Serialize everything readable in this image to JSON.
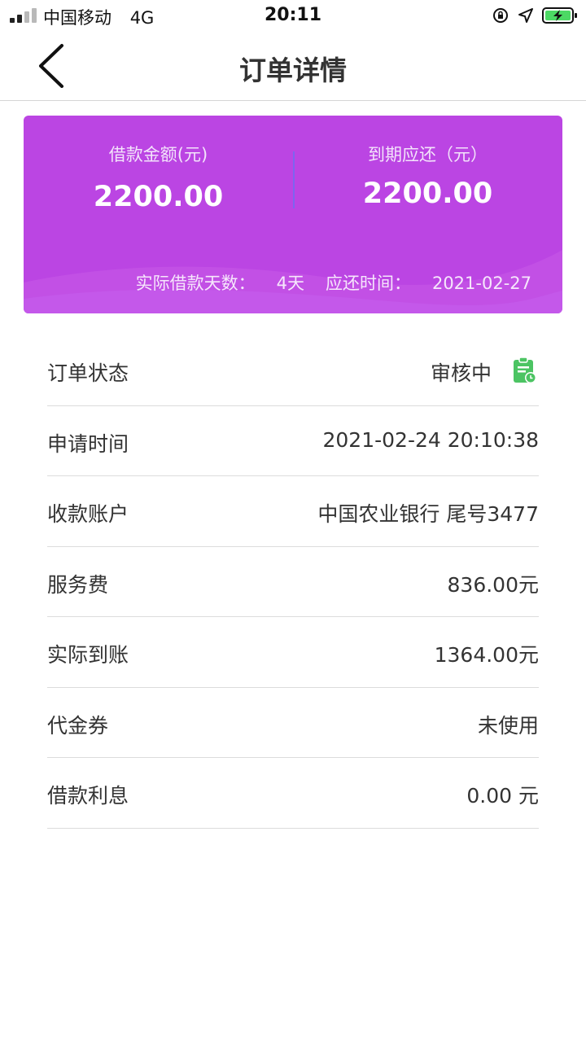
{
  "status_bar": {
    "carrier": "中国移动",
    "network": "4G",
    "time": "20:11",
    "battery_color": "#4cd964"
  },
  "nav": {
    "title": "订单详情"
  },
  "summary_card": {
    "background": "#bb45e3",
    "loan_amount_label": "借款金额(元)",
    "loan_amount_value": "2200.00",
    "due_amount_label": "到期应还（元）",
    "due_amount_value": "2200.00",
    "actual_days_label": "实际借款天数：",
    "actual_days_value": "4天",
    "due_date_label": "应还时间：",
    "due_date_value": "2021-02-27"
  },
  "details": [
    {
      "label": "订单状态",
      "value": "审核中",
      "icon": "clipboard-clock-icon",
      "icon_color": "#4cc463"
    },
    {
      "label": "申请时间",
      "value": "2021-02-24 20:10:38"
    },
    {
      "label": "收款账户",
      "value": "中国农业银行 尾号3477"
    },
    {
      "label": "服务费",
      "value": "836.00元"
    },
    {
      "label": "实际到账",
      "value": "1364.00元"
    },
    {
      "label": "代金券",
      "value": "未使用"
    },
    {
      "label": "借款利息",
      "value": "0.00 元"
    }
  ]
}
